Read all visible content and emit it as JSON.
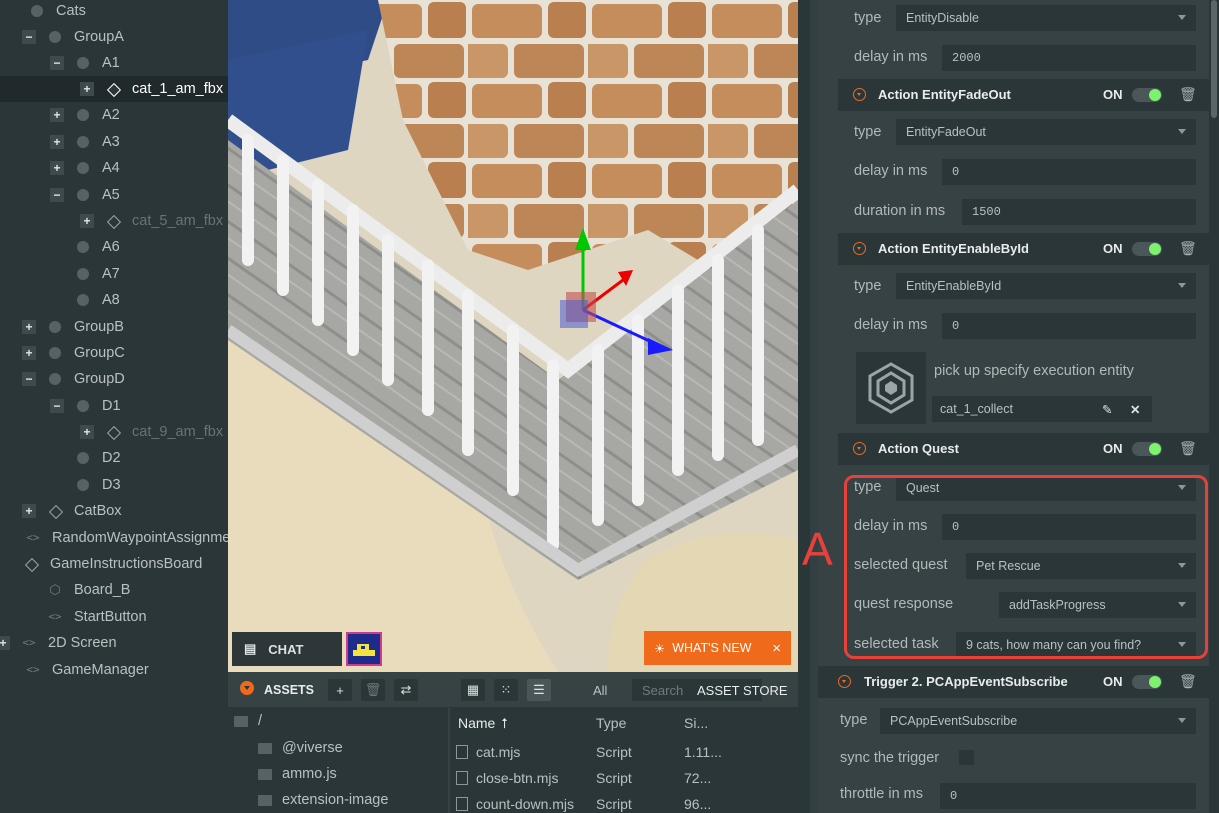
{
  "hierarchy": {
    "items": [
      {
        "label": "Cats",
        "toggle": "",
        "icon": "dot"
      },
      {
        "label": "GroupA",
        "toggle": "−",
        "icon": "dot"
      },
      {
        "label": "A1",
        "toggle": "−",
        "icon": "dot"
      },
      {
        "label": "cat_1_am_fbx",
        "toggle": "+",
        "icon": "diamond"
      },
      {
        "label": "A2",
        "toggle": "+",
        "icon": "dot"
      },
      {
        "label": "A3",
        "toggle": "+",
        "icon": "dot"
      },
      {
        "label": "A4",
        "toggle": "+",
        "icon": "dot"
      },
      {
        "label": "A5",
        "toggle": "−",
        "icon": "dot"
      },
      {
        "label": "cat_5_am_fbx",
        "toggle": "+",
        "icon": "diamond"
      },
      {
        "label": "A6",
        "toggle": "",
        "icon": "dot"
      },
      {
        "label": "A7",
        "toggle": "",
        "icon": "dot"
      },
      {
        "label": "A8",
        "toggle": "",
        "icon": "dot"
      },
      {
        "label": "GroupB",
        "toggle": "+",
        "icon": "dot"
      },
      {
        "label": "GroupC",
        "toggle": "+",
        "icon": "dot"
      },
      {
        "label": "GroupD",
        "toggle": "−",
        "icon": "dot"
      },
      {
        "label": "D1",
        "toggle": "−",
        "icon": "dot"
      },
      {
        "label": "cat_9_am_fbx",
        "toggle": "+",
        "icon": "diamond"
      },
      {
        "label": "D2",
        "toggle": "",
        "icon": "dot"
      },
      {
        "label": "D3",
        "toggle": "",
        "icon": "dot"
      },
      {
        "label": "CatBox",
        "toggle": "+",
        "icon": "diamond"
      },
      {
        "label": "RandomWaypointAssignme",
        "toggle": "",
        "icon": "code"
      },
      {
        "label": "GameInstructionsBoard",
        "toggle": "",
        "icon": "diamond"
      },
      {
        "label": "Board_B",
        "toggle": "",
        "icon": "hexagon"
      },
      {
        "label": "StartButton",
        "toggle": "",
        "icon": "code"
      },
      {
        "label": "2D Screen",
        "toggle": "+",
        "icon": "code"
      },
      {
        "label": "GameManager",
        "toggle": "",
        "icon": "code"
      }
    ]
  },
  "viewport": {
    "chat_label": "CHAT",
    "whats_new_label": "WHAT'S NEW",
    "whats_new_close": "×"
  },
  "assets": {
    "title": "ASSETS",
    "filter_all": "All",
    "search_placeholder": "Search",
    "store_label": "ASSET STORE",
    "root_folder": "/",
    "folders": [
      "@viverse",
      "ammo.js",
      "extension-image"
    ],
    "columns": {
      "name": "Name",
      "sort": "⭡",
      "type": "Type",
      "size": "Si..."
    },
    "files": [
      {
        "name": "cat.mjs",
        "type": "Script",
        "size": "1.11..."
      },
      {
        "name": "close-btn.mjs",
        "type": "Script",
        "size": "72..."
      },
      {
        "name": "count-down.mjs",
        "type": "Script",
        "size": "96..."
      }
    ]
  },
  "panel": {
    "top": {
      "type_label": "type",
      "type_value": "EntityDisable",
      "delay_label": "delay in ms",
      "delay_value": "2000"
    },
    "fadeout": {
      "title": "Action EntityFadeOut",
      "state": "ON",
      "type_label": "type",
      "type_value": "EntityFadeOut",
      "delay_label": "delay in ms",
      "delay_value": "0",
      "duration_label": "duration in ms",
      "duration_value": "1500"
    },
    "enable": {
      "title": "Action EntityEnableById",
      "state": "ON",
      "type_label": "type",
      "type_value": "EntityEnableById",
      "delay_label": "delay in ms",
      "delay_value": "0",
      "pick_label": "pick up specify execution entity",
      "entity_value": "cat_1_collect"
    },
    "quest": {
      "title": "Action Quest",
      "state": "ON",
      "type_label": "type",
      "type_value": "Quest",
      "delay_label": "delay in ms",
      "delay_value": "0",
      "selected_quest_label": "selected quest",
      "selected_quest_value": "Pet Rescue",
      "response_label": "quest response",
      "response_value": "addTaskProgress",
      "task_label": "selected task",
      "task_value": "9 cats, how many can you find?"
    },
    "trigger": {
      "title": "Trigger 2. PCAppEventSubscribe",
      "state": "ON",
      "type_label": "type",
      "type_value": "PCAppEventSubscribe",
      "sync_label": "sync the trigger",
      "throttle_label": "throttle in ms",
      "throttle_value": "0"
    }
  },
  "annotation": {
    "label": "A",
    "color": "#e8413a"
  },
  "colors": {
    "accent": "#f06a1b",
    "toggle_on": "#7cf26f",
    "panel_bg": "#364244",
    "field_bg": "#2b3639"
  }
}
